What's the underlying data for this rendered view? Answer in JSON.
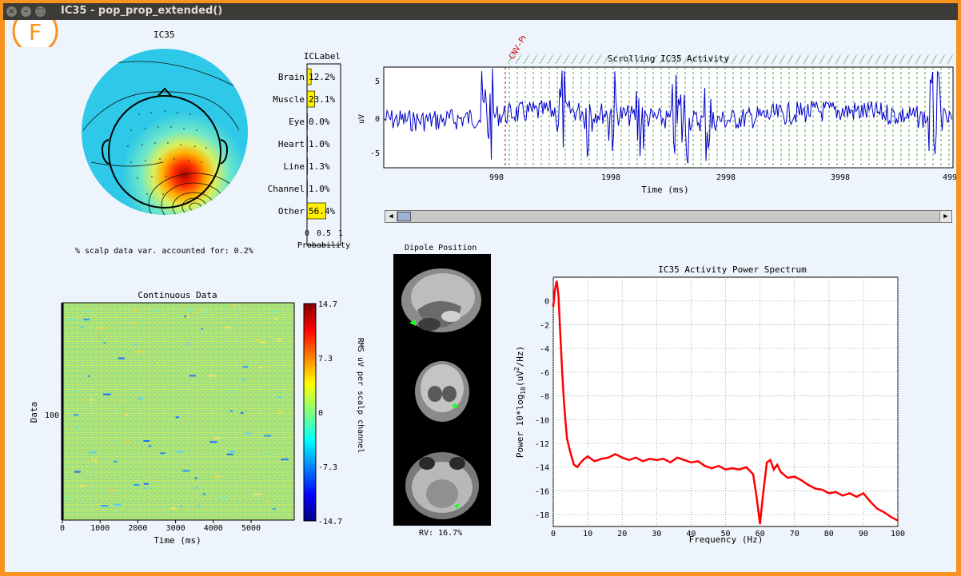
{
  "window": {
    "title": "IC35 - pop_prop_extended()"
  },
  "badge": {
    "letter": "F"
  },
  "topomap": {
    "title": "IC35",
    "variance_text": "% scalp data var. accounted for: 0.2%"
  },
  "iclabel": {
    "title": "ICLabel",
    "xlabel": "Probability",
    "ticks": [
      "0",
      "0.5",
      "1"
    ],
    "bars": [
      {
        "label": "Brain",
        "value_text": "12.2%",
        "value": 0.122
      },
      {
        "label": "Muscle",
        "value_text": "23.1%",
        "value": 0.231
      },
      {
        "label": "Eye",
        "value_text": "0.0%",
        "value": 0.0
      },
      {
        "label": "Heart",
        "value_text": "1.0%",
        "value": 0.01
      },
      {
        "label": "Line",
        "value_text": "1.3%",
        "value": 0.013
      },
      {
        "label": "Channel",
        "value_text": "1.0%",
        "value": 0.01
      },
      {
        "label": "Other",
        "value_text": "56.4%",
        "value": 0.564
      }
    ]
  },
  "activity": {
    "title": "Scrolling IC35 Activity",
    "event_label": "CNV-PRES",
    "ylabel": "uV",
    "yticks": [
      "5",
      "0",
      "-5"
    ],
    "xlabel": "Time (ms)",
    "xticks": [
      "998",
      "1998",
      "2998",
      "3998",
      "499"
    ]
  },
  "erpimage": {
    "title": "Continuous Data",
    "ylabel": "Data",
    "yticks": [
      "100"
    ],
    "xlabel": "Time (ms)",
    "xticks": [
      "0",
      "1000",
      "2000",
      "3000",
      "4000",
      "5000"
    ],
    "colorbar_ticks": [
      "14.7",
      "7.3",
      "0",
      "-7.3",
      "-14.7"
    ],
    "colorbar_label": "RMS uV per scalp channel"
  },
  "dipole": {
    "title": "Dipole Position",
    "rv": "RV: 16.7%"
  },
  "chart_data": {
    "type": "line",
    "title": "IC35 Activity Power Spectrum",
    "xlabel": "Frequency (Hz)",
    "ylabel": "Power 10*log10(uV2/Hz)",
    "xlim": [
      0,
      100
    ],
    "ylim": [
      -19,
      2
    ],
    "xticks": [
      "0",
      "10",
      "20",
      "30",
      "40",
      "50",
      "60",
      "70",
      "80",
      "90",
      "100"
    ],
    "yticks": [
      "0",
      "-2",
      "-4",
      "-6",
      "-8",
      "-10",
      "-12",
      "-14",
      "-16",
      "-18"
    ],
    "grid": true,
    "color": "#ff0000",
    "series": [
      {
        "x": [
          0,
          0.5,
          1,
          1.5,
          2,
          2.5,
          3,
          3.5,
          4,
          5,
          6,
          7,
          8,
          9,
          10,
          12,
          14,
          16,
          18,
          20,
          22,
          24,
          26,
          28,
          30,
          32,
          34,
          36,
          38,
          40,
          42,
          44,
          46,
          48,
          50,
          52,
          54,
          56,
          58,
          59,
          60,
          61,
          62,
          63,
          64,
          65,
          66,
          68,
          70,
          72,
          74,
          76,
          78,
          80,
          82,
          84,
          86,
          88,
          90,
          92,
          94,
          96,
          98,
          100
        ],
        "y": [
          -0.5,
          1,
          1.7,
          0.5,
          -2.5,
          -5.5,
          -8,
          -10,
          -11.6,
          -12.8,
          -13.8,
          -14,
          -13.6,
          -13.3,
          -13.1,
          -13.5,
          -13.3,
          -13.2,
          -12.9,
          -13.2,
          -13.4,
          -13.2,
          -13.5,
          -13.3,
          -13.4,
          -13.3,
          -13.6,
          -13.2,
          -13.4,
          -13.6,
          -13.5,
          -13.9,
          -14.1,
          -13.9,
          -14.2,
          -14.1,
          -14.2,
          -14.0,
          -14.6,
          -16.5,
          -18.8,
          -16.0,
          -13.6,
          -13.4,
          -14.2,
          -13.8,
          -14.4,
          -14.9,
          -14.8,
          -15.1,
          -15.5,
          -15.8,
          -15.9,
          -16.2,
          -16.1,
          -16.4,
          -16.2,
          -16.5,
          -16.2,
          -16.9,
          -17.5,
          -17.8,
          -18.2,
          -18.5
        ]
      }
    ]
  }
}
